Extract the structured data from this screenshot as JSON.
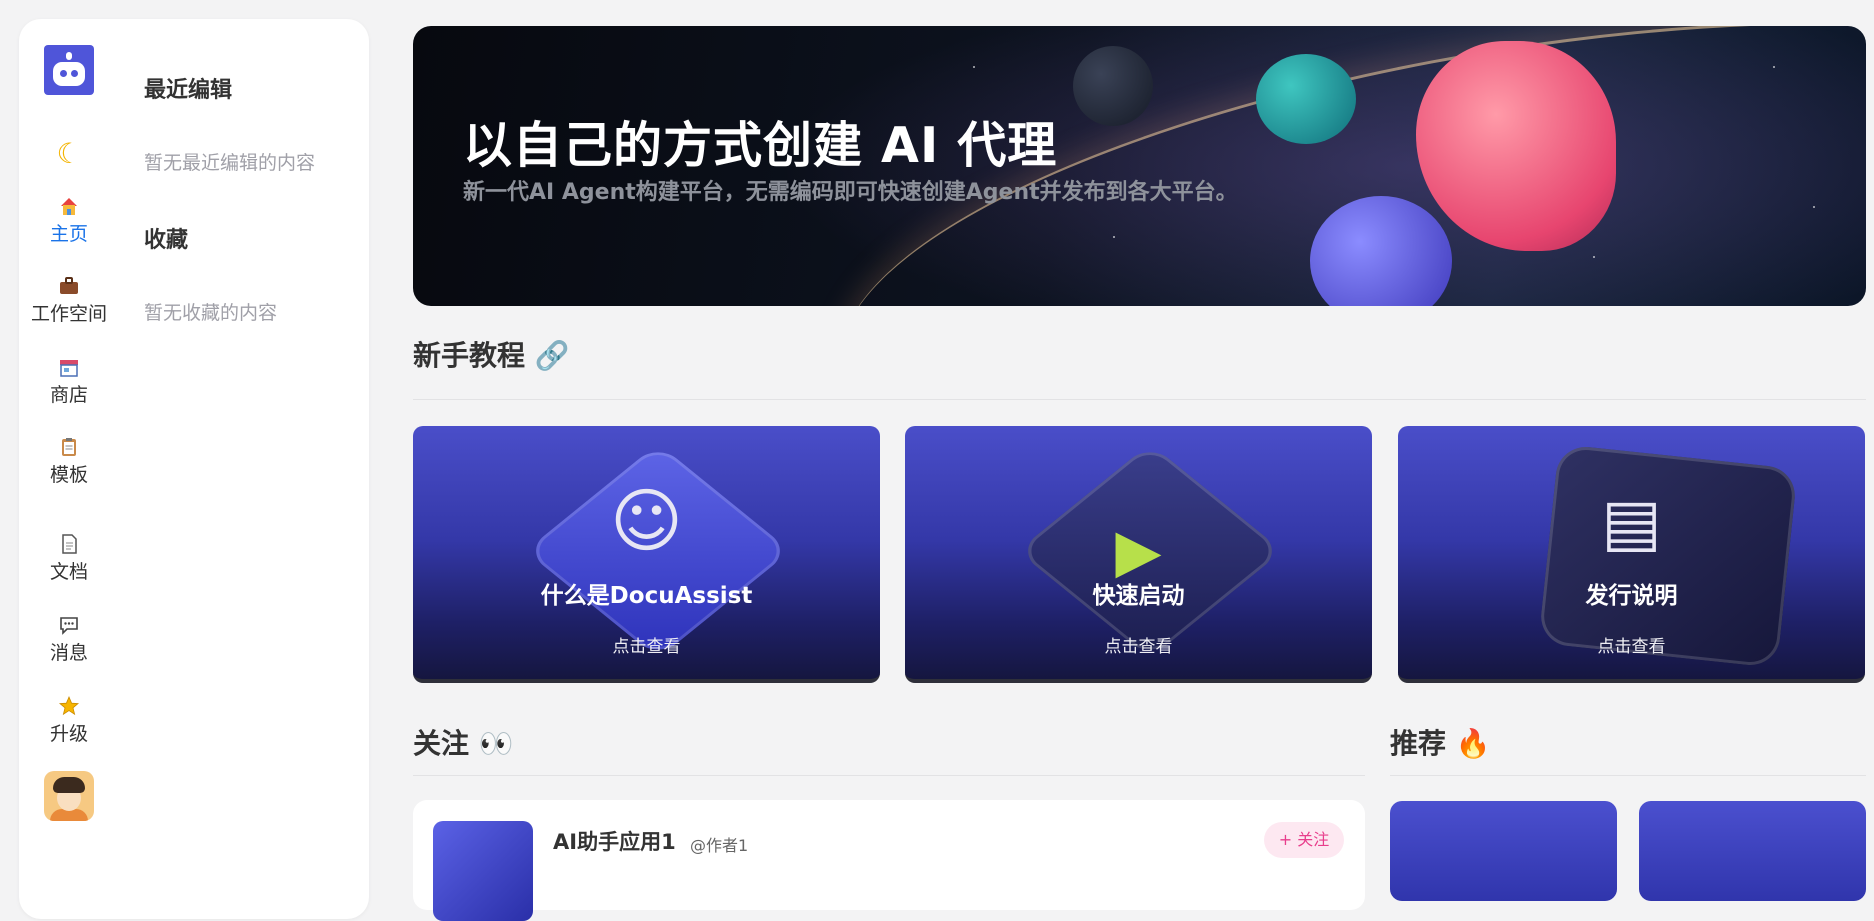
{
  "sidebar": {
    "nav": [
      {
        "label": "主页",
        "icon": "home-icon",
        "active": true
      },
      {
        "label": "工作空间",
        "icon": "briefcase-icon"
      },
      {
        "label": "商店",
        "icon": "store-icon"
      },
      {
        "label": "模板",
        "icon": "clipboard-icon"
      },
      {
        "label": "文档",
        "icon": "document-icon"
      },
      {
        "label": "消息",
        "icon": "message-icon"
      },
      {
        "label": "升级",
        "icon": "star-icon"
      }
    ],
    "recent_title": "最近编辑",
    "recent_empty": "暂无最近编辑的内容",
    "favorites_title": "收藏",
    "favorites_empty": "暂无收藏的内容"
  },
  "banner": {
    "title": "以自己的方式创建 AI 代理",
    "subtitle": "新一代AI Agent构建平台，无需编码即可快速创建Agent并发布到各大平台。"
  },
  "tutorials": {
    "title": "新手教程 🔗",
    "cards": [
      {
        "title": "什么是DocuAssist",
        "action": "点击查看"
      },
      {
        "title": "快速启动",
        "action": "点击查看"
      },
      {
        "title": "发行说明",
        "action": "点击查看"
      }
    ]
  },
  "following": {
    "title": "关注 👀",
    "items": [
      {
        "name": "AI助手应用1",
        "author": "@作者1",
        "follow_label": "+ 关注"
      }
    ]
  },
  "recommended": {
    "title": "推荐 🔥"
  },
  "colors": {
    "accent": "#1a73e8",
    "brand": "#4f55d9",
    "follow_pink": "#e83e8c"
  }
}
